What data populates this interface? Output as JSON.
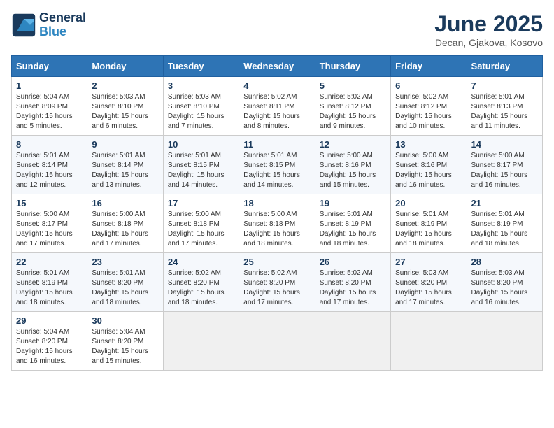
{
  "logo": {
    "line1": "General",
    "line2": "Blue"
  },
  "title": "June 2025",
  "subtitle": "Decan, Gjakova, Kosovo",
  "weekdays": [
    "Sunday",
    "Monday",
    "Tuesday",
    "Wednesday",
    "Thursday",
    "Friday",
    "Saturday"
  ],
  "weeks": [
    [
      {
        "day": "1",
        "info": "Sunrise: 5:04 AM\nSunset: 8:09 PM\nDaylight: 15 hours\nand 5 minutes."
      },
      {
        "day": "2",
        "info": "Sunrise: 5:03 AM\nSunset: 8:10 PM\nDaylight: 15 hours\nand 6 minutes."
      },
      {
        "day": "3",
        "info": "Sunrise: 5:03 AM\nSunset: 8:10 PM\nDaylight: 15 hours\nand 7 minutes."
      },
      {
        "day": "4",
        "info": "Sunrise: 5:02 AM\nSunset: 8:11 PM\nDaylight: 15 hours\nand 8 minutes."
      },
      {
        "day": "5",
        "info": "Sunrise: 5:02 AM\nSunset: 8:12 PM\nDaylight: 15 hours\nand 9 minutes."
      },
      {
        "day": "6",
        "info": "Sunrise: 5:02 AM\nSunset: 8:12 PM\nDaylight: 15 hours\nand 10 minutes."
      },
      {
        "day": "7",
        "info": "Sunrise: 5:01 AM\nSunset: 8:13 PM\nDaylight: 15 hours\nand 11 minutes."
      }
    ],
    [
      {
        "day": "8",
        "info": "Sunrise: 5:01 AM\nSunset: 8:14 PM\nDaylight: 15 hours\nand 12 minutes."
      },
      {
        "day": "9",
        "info": "Sunrise: 5:01 AM\nSunset: 8:14 PM\nDaylight: 15 hours\nand 13 minutes."
      },
      {
        "day": "10",
        "info": "Sunrise: 5:01 AM\nSunset: 8:15 PM\nDaylight: 15 hours\nand 14 minutes."
      },
      {
        "day": "11",
        "info": "Sunrise: 5:01 AM\nSunset: 8:15 PM\nDaylight: 15 hours\nand 14 minutes."
      },
      {
        "day": "12",
        "info": "Sunrise: 5:00 AM\nSunset: 8:16 PM\nDaylight: 15 hours\nand 15 minutes."
      },
      {
        "day": "13",
        "info": "Sunrise: 5:00 AM\nSunset: 8:16 PM\nDaylight: 15 hours\nand 16 minutes."
      },
      {
        "day": "14",
        "info": "Sunrise: 5:00 AM\nSunset: 8:17 PM\nDaylight: 15 hours\nand 16 minutes."
      }
    ],
    [
      {
        "day": "15",
        "info": "Sunrise: 5:00 AM\nSunset: 8:17 PM\nDaylight: 15 hours\nand 17 minutes."
      },
      {
        "day": "16",
        "info": "Sunrise: 5:00 AM\nSunset: 8:18 PM\nDaylight: 15 hours\nand 17 minutes."
      },
      {
        "day": "17",
        "info": "Sunrise: 5:00 AM\nSunset: 8:18 PM\nDaylight: 15 hours\nand 17 minutes."
      },
      {
        "day": "18",
        "info": "Sunrise: 5:00 AM\nSunset: 8:18 PM\nDaylight: 15 hours\nand 18 minutes."
      },
      {
        "day": "19",
        "info": "Sunrise: 5:01 AM\nSunset: 8:19 PM\nDaylight: 15 hours\nand 18 minutes."
      },
      {
        "day": "20",
        "info": "Sunrise: 5:01 AM\nSunset: 8:19 PM\nDaylight: 15 hours\nand 18 minutes."
      },
      {
        "day": "21",
        "info": "Sunrise: 5:01 AM\nSunset: 8:19 PM\nDaylight: 15 hours\nand 18 minutes."
      }
    ],
    [
      {
        "day": "22",
        "info": "Sunrise: 5:01 AM\nSunset: 8:19 PM\nDaylight: 15 hours\nand 18 minutes."
      },
      {
        "day": "23",
        "info": "Sunrise: 5:01 AM\nSunset: 8:20 PM\nDaylight: 15 hours\nand 18 minutes."
      },
      {
        "day": "24",
        "info": "Sunrise: 5:02 AM\nSunset: 8:20 PM\nDaylight: 15 hours\nand 18 minutes."
      },
      {
        "day": "25",
        "info": "Sunrise: 5:02 AM\nSunset: 8:20 PM\nDaylight: 15 hours\nand 17 minutes."
      },
      {
        "day": "26",
        "info": "Sunrise: 5:02 AM\nSunset: 8:20 PM\nDaylight: 15 hours\nand 17 minutes."
      },
      {
        "day": "27",
        "info": "Sunrise: 5:03 AM\nSunset: 8:20 PM\nDaylight: 15 hours\nand 17 minutes."
      },
      {
        "day": "28",
        "info": "Sunrise: 5:03 AM\nSunset: 8:20 PM\nDaylight: 15 hours\nand 16 minutes."
      }
    ],
    [
      {
        "day": "29",
        "info": "Sunrise: 5:04 AM\nSunset: 8:20 PM\nDaylight: 15 hours\nand 16 minutes."
      },
      {
        "day": "30",
        "info": "Sunrise: 5:04 AM\nSunset: 8:20 PM\nDaylight: 15 hours\nand 15 minutes."
      },
      {
        "day": "",
        "info": ""
      },
      {
        "day": "",
        "info": ""
      },
      {
        "day": "",
        "info": ""
      },
      {
        "day": "",
        "info": ""
      },
      {
        "day": "",
        "info": ""
      }
    ]
  ]
}
